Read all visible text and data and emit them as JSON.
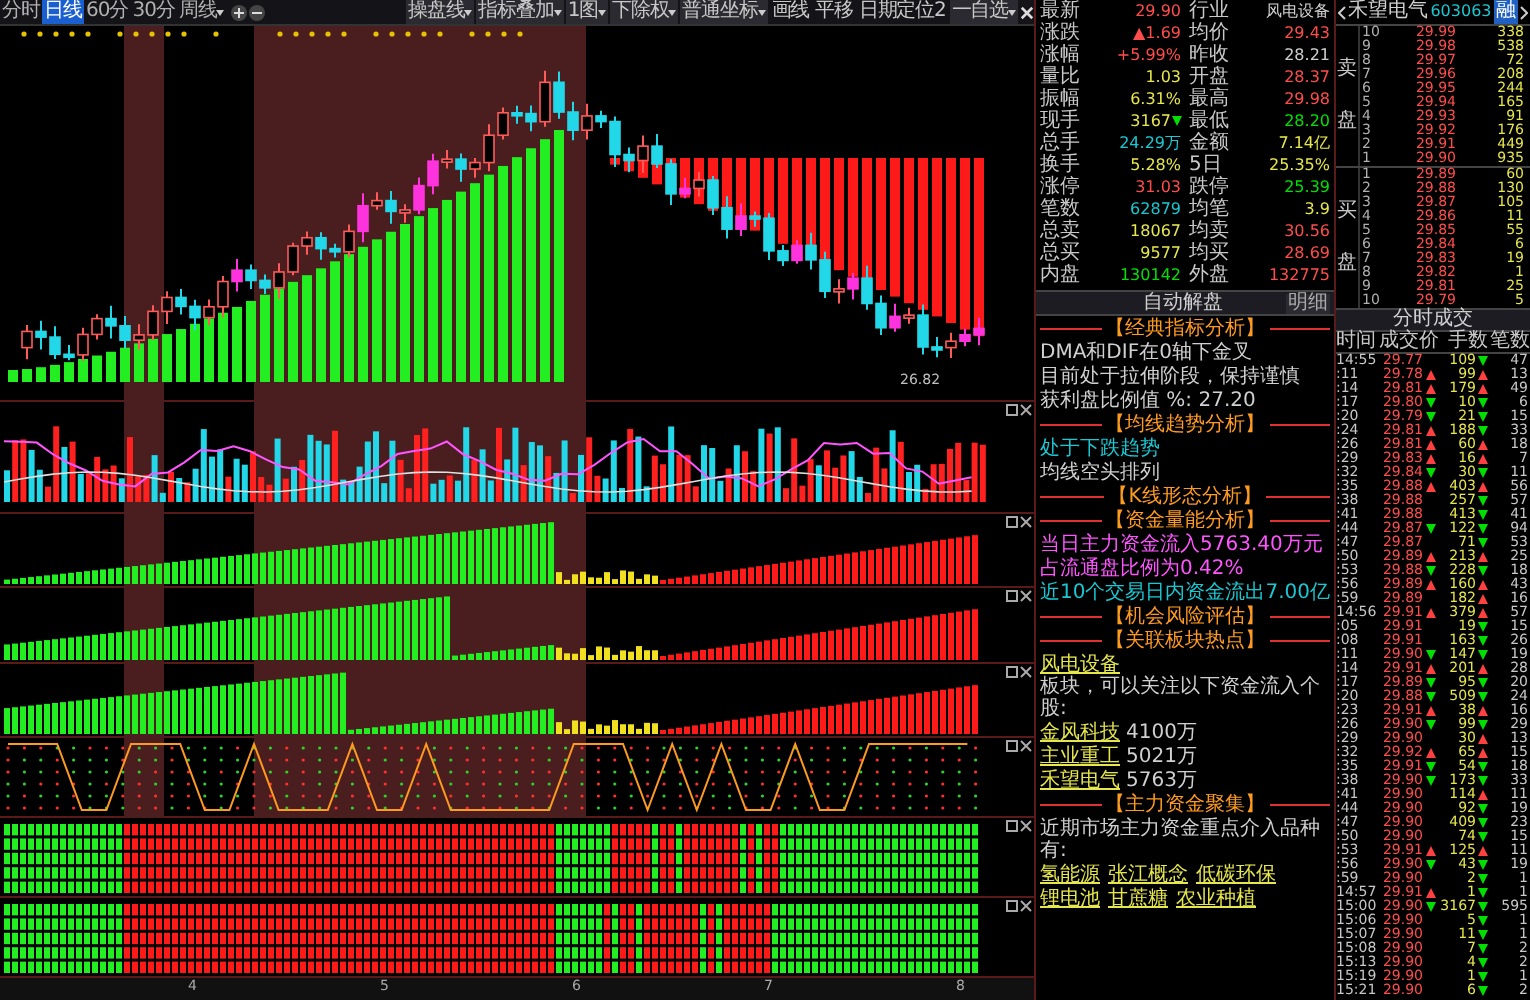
{
  "toolbar": {
    "periods": [
      {
        "label": "分时",
        "selected": false,
        "dropdown": false
      },
      {
        "label": "日线",
        "selected": true,
        "dropdown": false
      },
      {
        "label": "60分",
        "selected": false,
        "dropdown": false
      },
      {
        "label": "30分",
        "selected": false,
        "dropdown": false
      },
      {
        "label": "周线",
        "selected": false,
        "dropdown": true
      }
    ],
    "tools": [
      {
        "label": "操盘线",
        "dropdown": true
      },
      {
        "label": "指标叠加",
        "dropdown": true
      },
      {
        "label": "1图",
        "dropdown": true
      },
      {
        "label": "下除权",
        "dropdown": true
      },
      {
        "label": "普通坐标",
        "dropdown": true
      },
      {
        "label": "画线",
        "dropdown": false
      },
      {
        "label": "平移",
        "dropdown": false
      },
      {
        "label": "日期定位2",
        "dropdown": false
      },
      {
        "label": "一自选",
        "dropdown": true
      }
    ]
  },
  "chart": {
    "low_label": "26.82",
    "axis_labels": [
      "4",
      "5",
      "6",
      "7",
      "8"
    ]
  },
  "quote": {
    "rows": [
      [
        {
          "label": "最新",
          "value": "29.90",
          "color": "#ff4d4d"
        },
        {
          "label": "行业",
          "value": "风电设备",
          "color": "#d0d0d0"
        }
      ],
      [
        {
          "label": "涨跌",
          "value": "▲1.69",
          "color": "#ff4d4d"
        },
        {
          "label": "均价",
          "value": "29.43",
          "color": "#ff4d4d"
        }
      ],
      [
        {
          "label": "涨幅",
          "value": "+5.99%",
          "color": "#ff4d4d"
        },
        {
          "label": "昨收",
          "value": "28.21",
          "color": "#d0d0d0"
        }
      ],
      [
        {
          "label": "量比",
          "value": "1.03",
          "color": "#e6e64d"
        },
        {
          "label": "开盘",
          "value": "28.37",
          "color": "#ff4d4d"
        }
      ],
      [
        {
          "label": "振幅",
          "value": "6.31%",
          "color": "#e6e64d"
        },
        {
          "label": "最高",
          "value": "29.98",
          "color": "#ff4d4d"
        }
      ],
      [
        {
          "label": "现手",
          "value": "3167",
          "color": "#e6e64d",
          "fall": true
        },
        {
          "label": "最低",
          "value": "28.20",
          "color": "#00e000"
        }
      ],
      [
        {
          "label": "总手",
          "value": "24.29万",
          "color": "#19c8d2"
        },
        {
          "label": "金额",
          "value": "7.14亿",
          "color": "#e6e64d"
        }
      ],
      [
        {
          "label": "换手",
          "value": "5.28%",
          "color": "#e6e64d"
        },
        {
          "label": "5日",
          "value": "25.35%",
          "color": "#e6e64d"
        }
      ],
      [
        {
          "label": "涨停",
          "value": "31.03",
          "color": "#ff4d4d"
        },
        {
          "label": "跌停",
          "value": "25.39",
          "color": "#00e000"
        }
      ],
      [
        {
          "label": "笔数",
          "value": "62879",
          "color": "#19c8d2"
        },
        {
          "label": "均笔",
          "value": "3.9",
          "color": "#e6e64d"
        }
      ],
      [
        {
          "label": "总卖",
          "value": "18067",
          "color": "#e6e64d"
        },
        {
          "label": "均卖",
          "value": "30.56",
          "color": "#ff4d4d"
        }
      ],
      [
        {
          "label": "总买",
          "value": "9577",
          "color": "#e6e64d"
        },
        {
          "label": "均买",
          "value": "28.69",
          "color": "#ff4d4d"
        }
      ],
      [
        {
          "label": "内盘",
          "value": "130142",
          "color": "#00e000"
        },
        {
          "label": "外盘",
          "value": "132775",
          "color": "#ff4d4d"
        }
      ]
    ]
  },
  "analysis": {
    "title": "自动解盘",
    "detail_button": "明细",
    "lines": [
      {
        "kind": "heading",
        "text": "【经典指标分析】"
      },
      {
        "kind": "text",
        "color": "#d0d0d0",
        "text": "DMA和DIF在0轴下金叉"
      },
      {
        "kind": "text",
        "color": "#d0d0d0",
        "text": "目前处于拉伸阶段，保持谨慎"
      },
      {
        "kind": "text",
        "color": "#d0d0d0",
        "text": "获利盘比例值 %: 27.20"
      },
      {
        "kind": "heading",
        "text": "【均线趋势分析】"
      },
      {
        "kind": "text",
        "color": "#19c8d2",
        "text": "处于下跌趋势"
      },
      {
        "kind": "text",
        "color": "#d0d0d0",
        "text": "均线空头排列"
      },
      {
        "kind": "heading",
        "text": "【K线形态分析】"
      },
      {
        "kind": "heading",
        "text": "【资金量能分析】"
      },
      {
        "kind": "text",
        "color": "#ff55ff",
        "text": "当日主力资金流入5763.40万元"
      },
      {
        "kind": "text",
        "color": "#ff55ff",
        "text": "占流通盘比例为0.42%"
      },
      {
        "kind": "text",
        "color": "#19c8d2",
        "text": "近10个交易日内资金流出7.00亿"
      },
      {
        "kind": "heading",
        "text": "【机会风险评估】"
      },
      {
        "kind": "heading",
        "text": "【关联板块热点】"
      },
      {
        "kind": "sector",
        "name": "风电设备",
        "text": "板块，可以关注以下资金流入个股:"
      },
      {
        "kind": "stock",
        "name": "金风科技",
        "amount": "4100万"
      },
      {
        "kind": "stock",
        "name": "主业重工",
        "amount": "5021万"
      },
      {
        "kind": "stock",
        "name": "禾望电气",
        "amount": "5763万"
      },
      {
        "kind": "heading",
        "text": "【主力资金聚集】"
      },
      {
        "kind": "text",
        "color": "#d0d0d0",
        "text": "近期市场主力资金重点介入品种有:"
      },
      {
        "kind": "links",
        "items": [
          "氢能源",
          "张江概念",
          "低碳环保"
        ]
      },
      {
        "kind": "links",
        "items": [
          "锂电池",
          "甘蔗糖",
          "农业种植"
        ]
      }
    ]
  },
  "order_book": {
    "name": "禾望电气",
    "code": "603063",
    "badge": "融",
    "sell_label": "卖盘",
    "buy_label": "买盘",
    "asks": [
      {
        "rank": "10",
        "price": "29.99",
        "volume": "338"
      },
      {
        "rank": "9",
        "price": "29.98",
        "volume": "538"
      },
      {
        "rank": "8",
        "price": "29.97",
        "volume": "72"
      },
      {
        "rank": "7",
        "price": "29.96",
        "volume": "208"
      },
      {
        "rank": "6",
        "price": "29.95",
        "volume": "244"
      },
      {
        "rank": "5",
        "price": "29.94",
        "volume": "165"
      },
      {
        "rank": "4",
        "price": "29.93",
        "volume": "91"
      },
      {
        "rank": "3",
        "price": "29.92",
        "volume": "176"
      },
      {
        "rank": "2",
        "price": "29.91",
        "volume": "449"
      },
      {
        "rank": "1",
        "price": "29.90",
        "volume": "935"
      }
    ],
    "bids": [
      {
        "rank": "1",
        "price": "29.89",
        "volume": "60"
      },
      {
        "rank": "2",
        "price": "29.88",
        "volume": "130"
      },
      {
        "rank": "3",
        "price": "29.87",
        "volume": "105"
      },
      {
        "rank": "4",
        "price": "29.86",
        "volume": "11"
      },
      {
        "rank": "5",
        "price": "29.85",
        "volume": "55"
      },
      {
        "rank": "6",
        "price": "29.84",
        "volume": "6"
      },
      {
        "rank": "7",
        "price": "29.83",
        "volume": "19"
      },
      {
        "rank": "8",
        "price": "29.82",
        "volume": "1"
      },
      {
        "rank": "9",
        "price": "29.81",
        "volume": "25"
      },
      {
        "rank": "10",
        "price": "29.79",
        "volume": "5"
      }
    ]
  },
  "trades": {
    "title": "分时成交",
    "columns": [
      "时间",
      "成交价",
      "手数",
      "笔数"
    ],
    "rows": [
      {
        "time": "14:55",
        "price": "29.77",
        "price_rise": false,
        "price_fall": false,
        "volume": "109",
        "volume_rise": false,
        "count": "47"
      },
      {
        "time": ":11",
        "price": "29.78",
        "price_rise": true,
        "price_fall": false,
        "volume": "99",
        "volume_rise": true,
        "count": "13"
      },
      {
        "time": ":14",
        "price": "29.81",
        "price_rise": true,
        "price_fall": false,
        "volume": "179",
        "volume_rise": true,
        "count": "49"
      },
      {
        "time": ":17",
        "price": "29.80",
        "price_rise": false,
        "price_fall": true,
        "volume": "10",
        "volume_rise": false,
        "count": "6"
      },
      {
        "time": ":20",
        "price": "29.79",
        "price_rise": false,
        "price_fall": true,
        "volume": "21",
        "volume_rise": false,
        "count": "15"
      },
      {
        "time": ":24",
        "price": "29.81",
        "price_rise": true,
        "price_fall": false,
        "volume": "188",
        "volume_rise": false,
        "count": "33"
      },
      {
        "time": ":26",
        "price": "29.81",
        "price_rise": true,
        "price_fall": false,
        "volume": "60",
        "volume_rise": true,
        "count": "18"
      },
      {
        "time": ":29",
        "price": "29.83",
        "price_rise": true,
        "price_fall": false,
        "volume": "16",
        "volume_rise": true,
        "count": "7"
      },
      {
        "time": ":32",
        "price": "29.84",
        "price_rise": false,
        "price_fall": true,
        "volume": "30",
        "volume_rise": false,
        "count": "11"
      },
      {
        "time": ":35",
        "price": "29.88",
        "price_rise": true,
        "price_fall": false,
        "volume": "403",
        "volume_rise": true,
        "count": "56"
      },
      {
        "time": ":38",
        "price": "29.88",
        "price_rise": false,
        "price_fall": false,
        "volume": "257",
        "volume_rise": false,
        "count": "57"
      },
      {
        "time": ":41",
        "price": "29.88",
        "price_rise": false,
        "price_fall": false,
        "volume": "413",
        "volume_rise": false,
        "count": "41"
      },
      {
        "time": ":44",
        "price": "29.87",
        "price_rise": false,
        "price_fall": true,
        "volume": "122",
        "volume_rise": false,
        "count": "94"
      },
      {
        "time": ":47",
        "price": "29.87",
        "price_rise": false,
        "price_fall": false,
        "volume": "71",
        "volume_rise": false,
        "count": "53"
      },
      {
        "time": ":50",
        "price": "29.89",
        "price_rise": true,
        "price_fall": false,
        "volume": "213",
        "volume_rise": true,
        "count": "25"
      },
      {
        "time": ":53",
        "price": "29.88",
        "price_rise": false,
        "price_fall": true,
        "volume": "228",
        "volume_rise": false,
        "count": "18"
      },
      {
        "time": ":56",
        "price": "29.89",
        "price_rise": true,
        "price_fall": false,
        "volume": "160",
        "volume_rise": true,
        "count": "43"
      },
      {
        "time": ":59",
        "price": "29.89",
        "price_rise": false,
        "price_fall": false,
        "volume": "182",
        "volume_rise": true,
        "count": "16"
      },
      {
        "time": "14:56",
        "price": "29.91",
        "price_rise": true,
        "price_fall": false,
        "volume": "379",
        "volume_rise": true,
        "count": "57"
      },
      {
        "time": ":05",
        "price": "29.91",
        "price_rise": false,
        "price_fall": false,
        "volume": "19",
        "volume_rise": false,
        "count": "15"
      },
      {
        "time": ":08",
        "price": "29.91",
        "price_rise": false,
        "price_fall": false,
        "volume": "163",
        "volume_rise": false,
        "count": "26"
      },
      {
        "time": ":11",
        "price": "29.90",
        "price_rise": false,
        "price_fall": true,
        "volume": "147",
        "volume_rise": false,
        "count": "19"
      },
      {
        "time": ":14",
        "price": "29.91",
        "price_rise": true,
        "price_fall": false,
        "volume": "201",
        "volume_rise": true,
        "count": "28"
      },
      {
        "time": ":17",
        "price": "29.89",
        "price_rise": false,
        "price_fall": true,
        "volume": "95",
        "volume_rise": false,
        "count": "20"
      },
      {
        "time": ":20",
        "price": "29.88",
        "price_rise": false,
        "price_fall": true,
        "volume": "509",
        "volume_rise": false,
        "count": "24"
      },
      {
        "time": ":23",
        "price": "29.91",
        "price_rise": true,
        "price_fall": false,
        "volume": "38",
        "volume_rise": true,
        "count": "16"
      },
      {
        "time": ":26",
        "price": "29.90",
        "price_rise": false,
        "price_fall": true,
        "volume": "99",
        "volume_rise": false,
        "count": "29"
      },
      {
        "time": ":29",
        "price": "29.90",
        "price_rise": false,
        "price_fall": false,
        "volume": "30",
        "volume_rise": true,
        "count": "13"
      },
      {
        "time": ":32",
        "price": "29.92",
        "price_rise": true,
        "price_fall": false,
        "volume": "65",
        "volume_rise": true,
        "count": "15"
      },
      {
        "time": ":35",
        "price": "29.91",
        "price_rise": false,
        "price_fall": true,
        "volume": "54",
        "volume_rise": false,
        "count": "18"
      },
      {
        "time": ":38",
        "price": "29.90",
        "price_rise": false,
        "price_fall": true,
        "volume": "173",
        "volume_rise": false,
        "count": "33"
      },
      {
        "time": ":41",
        "price": "29.90",
        "price_rise": false,
        "price_fall": false,
        "volume": "114",
        "volume_rise": true,
        "count": "11"
      },
      {
        "time": ":44",
        "price": "29.90",
        "price_rise": false,
        "price_fall": false,
        "volume": "92",
        "volume_rise": false,
        "count": "19"
      },
      {
        "time": ":47",
        "price": "29.90",
        "price_rise": false,
        "price_fall": false,
        "volume": "409",
        "volume_rise": false,
        "count": "23"
      },
      {
        "time": ":50",
        "price": "29.90",
        "price_rise": false,
        "price_fall": false,
        "volume": "74",
        "volume_rise": false,
        "count": "15"
      },
      {
        "time": ":53",
        "price": "29.91",
        "price_rise": true,
        "price_fall": false,
        "volume": "125",
        "volume_rise": true,
        "count": "11"
      },
      {
        "time": ":56",
        "price": "29.90",
        "price_rise": false,
        "price_fall": true,
        "volume": "43",
        "volume_rise": false,
        "count": "19"
      },
      {
        "time": ":59",
        "price": "29.90",
        "price_rise": false,
        "price_fall": false,
        "volume": "2",
        "volume_rise": false,
        "count": "1"
      },
      {
        "time": "14:57",
        "price": "29.91",
        "price_rise": true,
        "price_fall": false,
        "volume": "1",
        "volume_rise": false,
        "count": "1"
      },
      {
        "time": "15:00",
        "price": "29.90",
        "price_rise": false,
        "price_fall": true,
        "volume": "3167",
        "volume_rise": false,
        "count": "595"
      },
      {
        "time": "15:06",
        "price": "29.90",
        "price_rise": false,
        "price_fall": false,
        "volume": "5",
        "volume_rise": false,
        "count": "1"
      },
      {
        "time": "15:07",
        "price": "29.90",
        "price_rise": false,
        "price_fall": false,
        "volume": "11",
        "volume_rise": false,
        "count": "1"
      },
      {
        "time": "15:08",
        "price": "29.90",
        "price_rise": false,
        "price_fall": false,
        "volume": "7",
        "volume_rise": false,
        "count": "2"
      },
      {
        "time": "15:13",
        "price": "29.90",
        "price_rise": false,
        "price_fall": false,
        "volume": "4",
        "volume_rise": false,
        "count": "2"
      },
      {
        "time": "15:19",
        "price": "29.90",
        "price_rise": false,
        "price_fall": false,
        "volume": "1",
        "volume_rise": false,
        "count": "1"
      },
      {
        "time": "15:21",
        "price": "29.90",
        "price_rise": false,
        "price_fall": false,
        "volume": "6",
        "volume_rise": false,
        "count": "2"
      }
    ]
  }
}
